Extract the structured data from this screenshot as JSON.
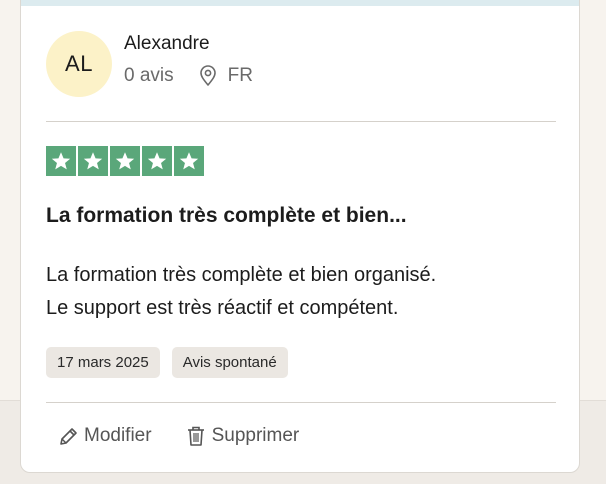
{
  "reviewer": {
    "initials": "AL",
    "name": "Alexandre",
    "reviews_count": "0 avis",
    "country": "FR"
  },
  "rating": {
    "stars": 5,
    "max_stars": 5,
    "color": "#5aa77a"
  },
  "review": {
    "title": "La formation très complète et bien...",
    "body_line_1": "La formation très complète et bien organisé.",
    "body_line_2": "Le support est très réactif et compétent."
  },
  "tags": {
    "date": "17 mars 2025",
    "type": "Avis spontané"
  },
  "actions": {
    "edit_label": "Modifier",
    "delete_label": "Supprimer"
  },
  "icons": {
    "location": "location-pin-icon",
    "star": "star-icon",
    "edit": "pencil-icon",
    "delete": "trash-icon"
  }
}
